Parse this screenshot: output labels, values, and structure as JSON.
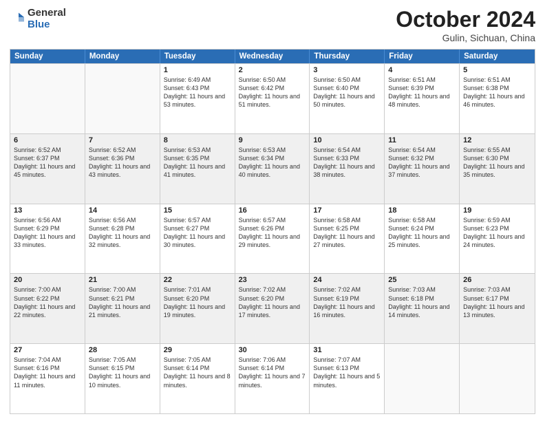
{
  "logo": {
    "general": "General",
    "blue": "Blue"
  },
  "title": {
    "month": "October 2024",
    "location": "Gulin, Sichuan, China"
  },
  "header_days": [
    "Sunday",
    "Monday",
    "Tuesday",
    "Wednesday",
    "Thursday",
    "Friday",
    "Saturday"
  ],
  "rows": [
    [
      {
        "day": "",
        "info": "",
        "empty": true
      },
      {
        "day": "",
        "info": "",
        "empty": true
      },
      {
        "day": "1",
        "info": "Sunrise: 6:49 AM\nSunset: 6:43 PM\nDaylight: 11 hours and 53 minutes."
      },
      {
        "day": "2",
        "info": "Sunrise: 6:50 AM\nSunset: 6:42 PM\nDaylight: 11 hours and 51 minutes."
      },
      {
        "day": "3",
        "info": "Sunrise: 6:50 AM\nSunset: 6:40 PM\nDaylight: 11 hours and 50 minutes."
      },
      {
        "day": "4",
        "info": "Sunrise: 6:51 AM\nSunset: 6:39 PM\nDaylight: 11 hours and 48 minutes."
      },
      {
        "day": "5",
        "info": "Sunrise: 6:51 AM\nSunset: 6:38 PM\nDaylight: 11 hours and 46 minutes."
      }
    ],
    [
      {
        "day": "6",
        "info": "Sunrise: 6:52 AM\nSunset: 6:37 PM\nDaylight: 11 hours and 45 minutes."
      },
      {
        "day": "7",
        "info": "Sunrise: 6:52 AM\nSunset: 6:36 PM\nDaylight: 11 hours and 43 minutes."
      },
      {
        "day": "8",
        "info": "Sunrise: 6:53 AM\nSunset: 6:35 PM\nDaylight: 11 hours and 41 minutes."
      },
      {
        "day": "9",
        "info": "Sunrise: 6:53 AM\nSunset: 6:34 PM\nDaylight: 11 hours and 40 minutes."
      },
      {
        "day": "10",
        "info": "Sunrise: 6:54 AM\nSunset: 6:33 PM\nDaylight: 11 hours and 38 minutes."
      },
      {
        "day": "11",
        "info": "Sunrise: 6:54 AM\nSunset: 6:32 PM\nDaylight: 11 hours and 37 minutes."
      },
      {
        "day": "12",
        "info": "Sunrise: 6:55 AM\nSunset: 6:30 PM\nDaylight: 11 hours and 35 minutes."
      }
    ],
    [
      {
        "day": "13",
        "info": "Sunrise: 6:56 AM\nSunset: 6:29 PM\nDaylight: 11 hours and 33 minutes."
      },
      {
        "day": "14",
        "info": "Sunrise: 6:56 AM\nSunset: 6:28 PM\nDaylight: 11 hours and 32 minutes."
      },
      {
        "day": "15",
        "info": "Sunrise: 6:57 AM\nSunset: 6:27 PM\nDaylight: 11 hours and 30 minutes."
      },
      {
        "day": "16",
        "info": "Sunrise: 6:57 AM\nSunset: 6:26 PM\nDaylight: 11 hours and 29 minutes."
      },
      {
        "day": "17",
        "info": "Sunrise: 6:58 AM\nSunset: 6:25 PM\nDaylight: 11 hours and 27 minutes."
      },
      {
        "day": "18",
        "info": "Sunrise: 6:58 AM\nSunset: 6:24 PM\nDaylight: 11 hours and 25 minutes."
      },
      {
        "day": "19",
        "info": "Sunrise: 6:59 AM\nSunset: 6:23 PM\nDaylight: 11 hours and 24 minutes."
      }
    ],
    [
      {
        "day": "20",
        "info": "Sunrise: 7:00 AM\nSunset: 6:22 PM\nDaylight: 11 hours and 22 minutes."
      },
      {
        "day": "21",
        "info": "Sunrise: 7:00 AM\nSunset: 6:21 PM\nDaylight: 11 hours and 21 minutes."
      },
      {
        "day": "22",
        "info": "Sunrise: 7:01 AM\nSunset: 6:20 PM\nDaylight: 11 hours and 19 minutes."
      },
      {
        "day": "23",
        "info": "Sunrise: 7:02 AM\nSunset: 6:20 PM\nDaylight: 11 hours and 17 minutes."
      },
      {
        "day": "24",
        "info": "Sunrise: 7:02 AM\nSunset: 6:19 PM\nDaylight: 11 hours and 16 minutes."
      },
      {
        "day": "25",
        "info": "Sunrise: 7:03 AM\nSunset: 6:18 PM\nDaylight: 11 hours and 14 minutes."
      },
      {
        "day": "26",
        "info": "Sunrise: 7:03 AM\nSunset: 6:17 PM\nDaylight: 11 hours and 13 minutes."
      }
    ],
    [
      {
        "day": "27",
        "info": "Sunrise: 7:04 AM\nSunset: 6:16 PM\nDaylight: 11 hours and 11 minutes."
      },
      {
        "day": "28",
        "info": "Sunrise: 7:05 AM\nSunset: 6:15 PM\nDaylight: 11 hours and 10 minutes."
      },
      {
        "day": "29",
        "info": "Sunrise: 7:05 AM\nSunset: 6:14 PM\nDaylight: 11 hours and 8 minutes."
      },
      {
        "day": "30",
        "info": "Sunrise: 7:06 AM\nSunset: 6:14 PM\nDaylight: 11 hours and 7 minutes."
      },
      {
        "day": "31",
        "info": "Sunrise: 7:07 AM\nSunset: 6:13 PM\nDaylight: 11 hours and 5 minutes."
      },
      {
        "day": "",
        "info": "",
        "empty": true
      },
      {
        "day": "",
        "info": "",
        "empty": true
      }
    ]
  ]
}
